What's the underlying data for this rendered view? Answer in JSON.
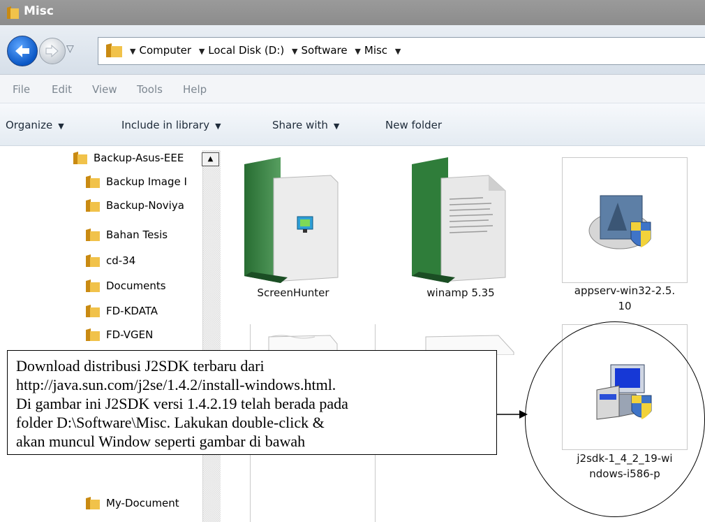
{
  "window": {
    "title": "Misc"
  },
  "address": {
    "crumbs": [
      "Computer",
      "Local Disk (D:)",
      "Software",
      "Misc"
    ]
  },
  "menu": [
    "File",
    "Edit",
    "View",
    "Tools",
    "Help"
  ],
  "commands": {
    "organize": "Organize",
    "include_in_library": "Include in library",
    "share_with": "Share with",
    "new_folder": "New folder"
  },
  "nav": {
    "items": [
      "Backup-Asus-EEE",
      "Backup Image I",
      "Backup-Noviya",
      "Bahan Tesis",
      "cd-34",
      "Documents",
      "FD-KDATA",
      "FD-VGEN",
      "My-Document"
    ]
  },
  "files": [
    {
      "name": "ScreenHunter",
      "icon": "green-folder-doc-icon"
    },
    {
      "name": "winamp 5.35",
      "icon": "green-folder-doc-icon"
    },
    {
      "name": "appserv-win32-2.5.10",
      "line1": "appserv-win32-2.5.",
      "line2": "10",
      "icon": "installer-icon"
    },
    {
      "name": "j2sdk-1_4_2_19-windows-i586-p",
      "line1": "j2sdk-1_4_2_19-wi",
      "line2": "ndows-i586-p",
      "icon": "setup-icon"
    }
  ],
  "callout": {
    "lines": [
      "Download distribusi J2SDK terbaru dari",
      "http://java.sun.com/j2se/1.4.2/install-windows.html.",
      "Di gambar ini J2SDK versi 1.4.2.19 telah berada pada",
      "folder D:\\Software\\Misc. Lakukan double-click &",
      "akan muncul Window seperti gambar di bawah"
    ]
  },
  "colors": {
    "folder": "#e8b33a",
    "green": "#2f7d3a",
    "titlebar": "#8c8c8c"
  }
}
